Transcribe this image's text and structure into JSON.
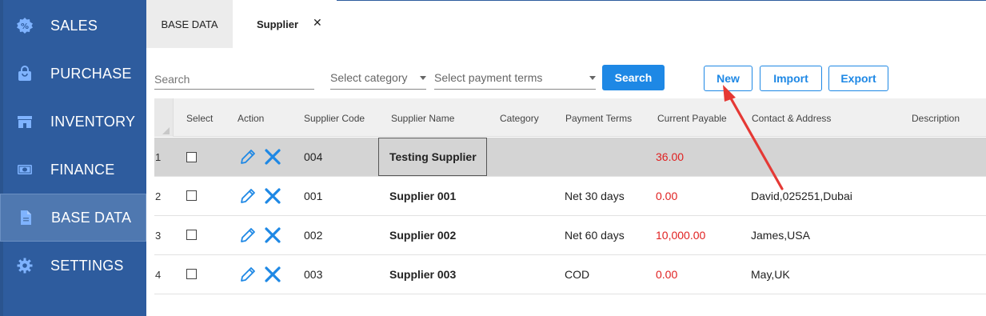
{
  "sidebar": {
    "items": [
      {
        "label": "SALES",
        "icon": "sales-icon"
      },
      {
        "label": "PURCHASE",
        "icon": "purchase-bag-icon"
      },
      {
        "label": "INVENTORY",
        "icon": "inventory-store-icon"
      },
      {
        "label": "FINANCE",
        "icon": "finance-money-icon"
      },
      {
        "label": "BASE DATA",
        "icon": "document-icon",
        "active": true
      },
      {
        "label": "SETTINGS",
        "icon": "gear-icon"
      }
    ]
  },
  "tabs": {
    "base": "BASE DATA",
    "supplier": "Supplier",
    "close": "✕"
  },
  "toolbar": {
    "search_placeholder": "Search",
    "category_select": "Select category",
    "payment_select": "Select payment terms",
    "search_button": "Search",
    "new_button": "New",
    "import_button": "Import",
    "export_button": "Export"
  },
  "table": {
    "headers": {
      "select": "Select",
      "action": "Action",
      "code": "Supplier Code",
      "name": "Supplier Name",
      "category": "Category",
      "terms": "Payment Terms",
      "payable": "Current Payable",
      "contact": "Contact & Address",
      "description": "Description"
    },
    "rows": [
      {
        "num": "1",
        "code": "004",
        "name": "Testing Supplier",
        "category": "",
        "terms": "",
        "payable": "36.00",
        "contact": "",
        "description": ""
      },
      {
        "num": "2",
        "code": "001",
        "name": "Supplier 001",
        "category": "",
        "terms": "Net 30 days",
        "payable": "0.00",
        "contact": "David,025251,Dubai",
        "description": ""
      },
      {
        "num": "3",
        "code": "002",
        "name": "Supplier 002",
        "category": "",
        "terms": "Net 60 days",
        "payable": "10,000.00",
        "contact": "James,USA",
        "description": ""
      },
      {
        "num": "4",
        "code": "003",
        "name": "Supplier 003",
        "category": "",
        "terms": "COD",
        "payable": "0.00",
        "contact": "May,UK",
        "description": ""
      }
    ]
  },
  "colors": {
    "sidebar": "#2e5c9e",
    "accent": "#1e88e5",
    "payable": "#e02020",
    "annotation_arrow": "#e53935"
  }
}
